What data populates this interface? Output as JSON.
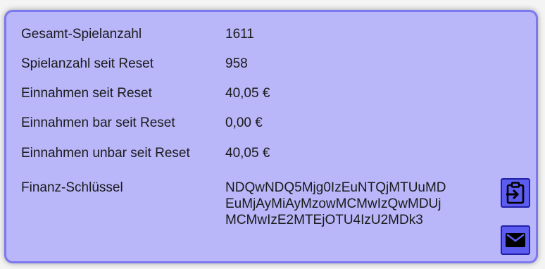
{
  "stats": {
    "rows": [
      {
        "label": "Gesamt-Spielanzahl",
        "value": "1611"
      },
      {
        "label": "Spielanzahl seit Reset",
        "value": "958"
      },
      {
        "label": "Einnahmen seit Reset",
        "value": "40,05 €"
      },
      {
        "label": "Einnahmen bar seit Reset",
        "value": "0,00 €"
      },
      {
        "label": "Einnahmen unbar seit Reset",
        "value": "40,05 €"
      }
    ],
    "finance_key": {
      "label": "Finanz-Schlüssel",
      "lines": [
        "NDQwNDQ5Mjg0IzEuNTQjMTUuMD",
        "EuMjAyMiAyMzowMCMwIzQwMDUj",
        "MCMwIzE2MTEjOTU4IzU2MDk3"
      ]
    }
  },
  "buttons": {
    "copy_icon": "clipboard-paste-icon",
    "mail_icon": "envelope-icon"
  },
  "colors": {
    "panel_bg": "#b9b6f9",
    "panel_border": "#7c78ef",
    "button_bg": "#5c5cf0",
    "button_border": "#2020a8"
  }
}
